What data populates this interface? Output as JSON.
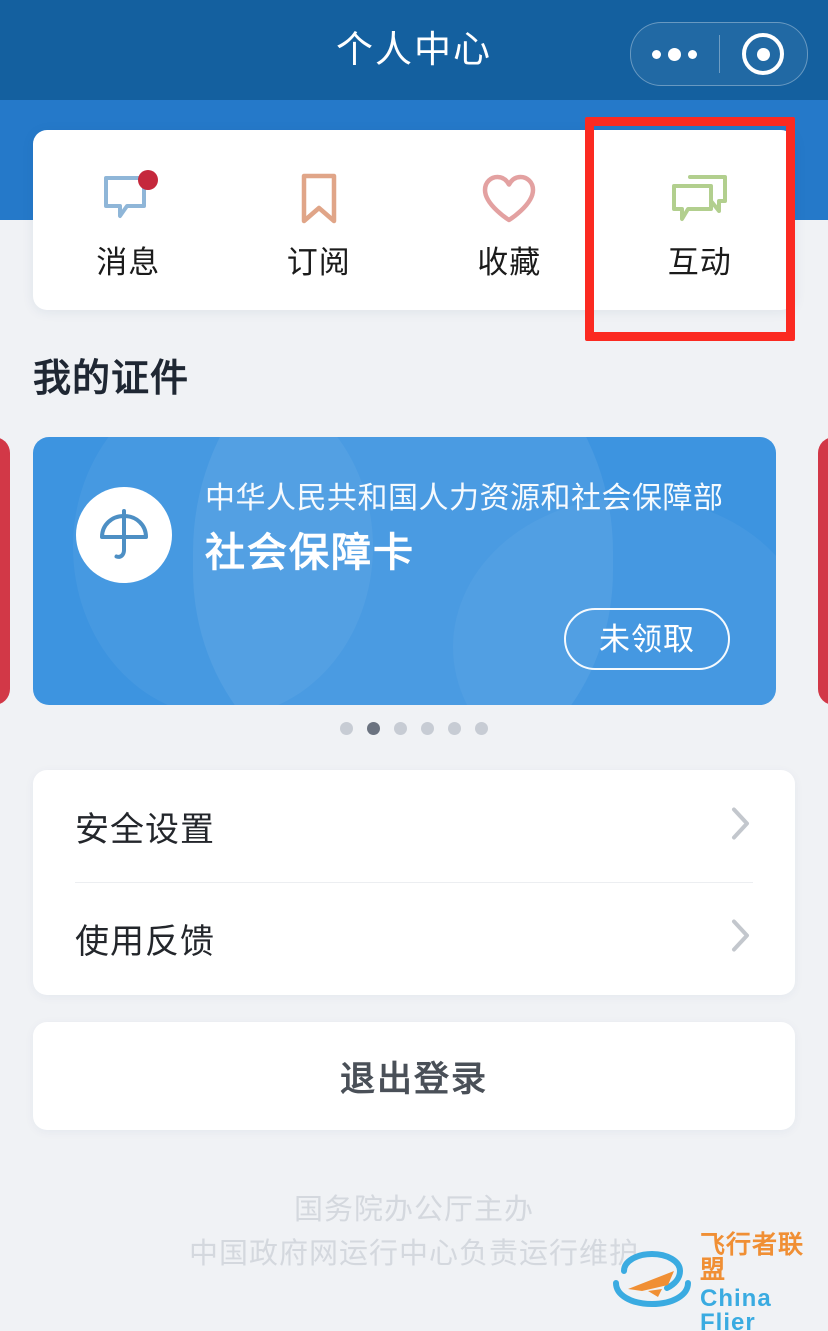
{
  "navbar": {
    "title": "个人中心",
    "capsule": {
      "more_icon": "more-dots-icon",
      "target_icon": "target-circle-icon"
    }
  },
  "quicknav": {
    "items": [
      {
        "label": "消息",
        "icon": "chat-bubble-icon",
        "color": "#8fb6d8",
        "badge": true
      },
      {
        "label": "订阅",
        "icon": "bookmark-icon",
        "color": "#e0a588",
        "badge": false
      },
      {
        "label": "收藏",
        "icon": "heart-icon",
        "color": "#e3a1a1",
        "badge": false
      },
      {
        "label": "互动",
        "icon": "chat-double-icon",
        "color": "#b2cf8e",
        "badge": false
      }
    ],
    "highlighted_index": 3,
    "highlight_color": "#fb2a21"
  },
  "section": {
    "title": "我的证件"
  },
  "cert_card": {
    "logo_icon": "umbrella-icon",
    "organization": "中华人民共和国人力资源和社会保障部",
    "name": "社会保障卡",
    "status": "未领取",
    "bg_color": "#3d94e0",
    "peek_color": "#d23847"
  },
  "pagination": {
    "total": 6,
    "active_index": 1
  },
  "settings": {
    "rows": [
      {
        "label": "安全设置",
        "chevron": "chevron-right-icon"
      },
      {
        "label": "使用反馈",
        "chevron": "chevron-right-icon"
      }
    ]
  },
  "logout": {
    "label": "退出登录"
  },
  "footer": {
    "line1": "国务院办公厅主办",
    "line2": "中国政府网运行中心负责运行维护"
  },
  "watermark": {
    "cn": "飞行者联盟",
    "en": "China Flier",
    "icon": "plane-orbit-icon",
    "cn_color": "#f08a2a",
    "en_color": "#31a8e0"
  }
}
